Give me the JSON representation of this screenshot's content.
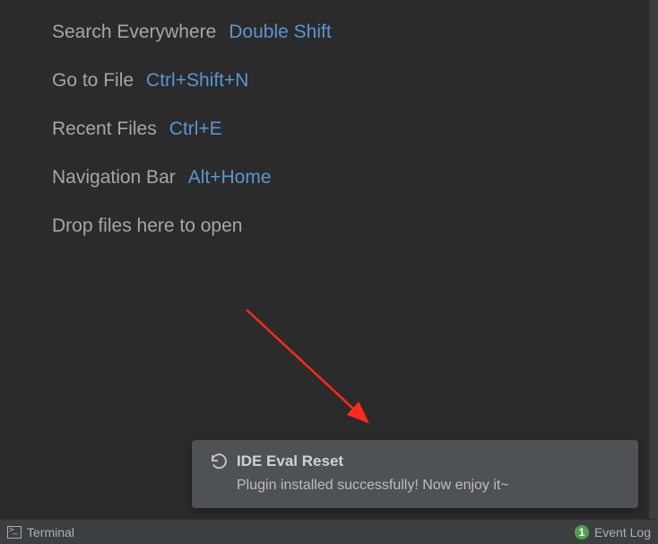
{
  "hints": {
    "search_everywhere": {
      "label": "Search Everywhere",
      "shortcut": "Double Shift"
    },
    "go_to_file": {
      "label": "Go to File",
      "shortcut": "Ctrl+Shift+N"
    },
    "recent_files": {
      "label": "Recent Files",
      "shortcut": "Ctrl+E"
    },
    "navigation_bar": {
      "label": "Navigation Bar",
      "shortcut": "Alt+Home"
    },
    "drop_files": "Drop files here to open"
  },
  "notification": {
    "title": "IDE Eval Reset",
    "body": "Plugin installed successfully! Now enjoy it~"
  },
  "statusbar": {
    "terminal": "Terminal",
    "event_log": "Event Log",
    "event_count": "1"
  }
}
